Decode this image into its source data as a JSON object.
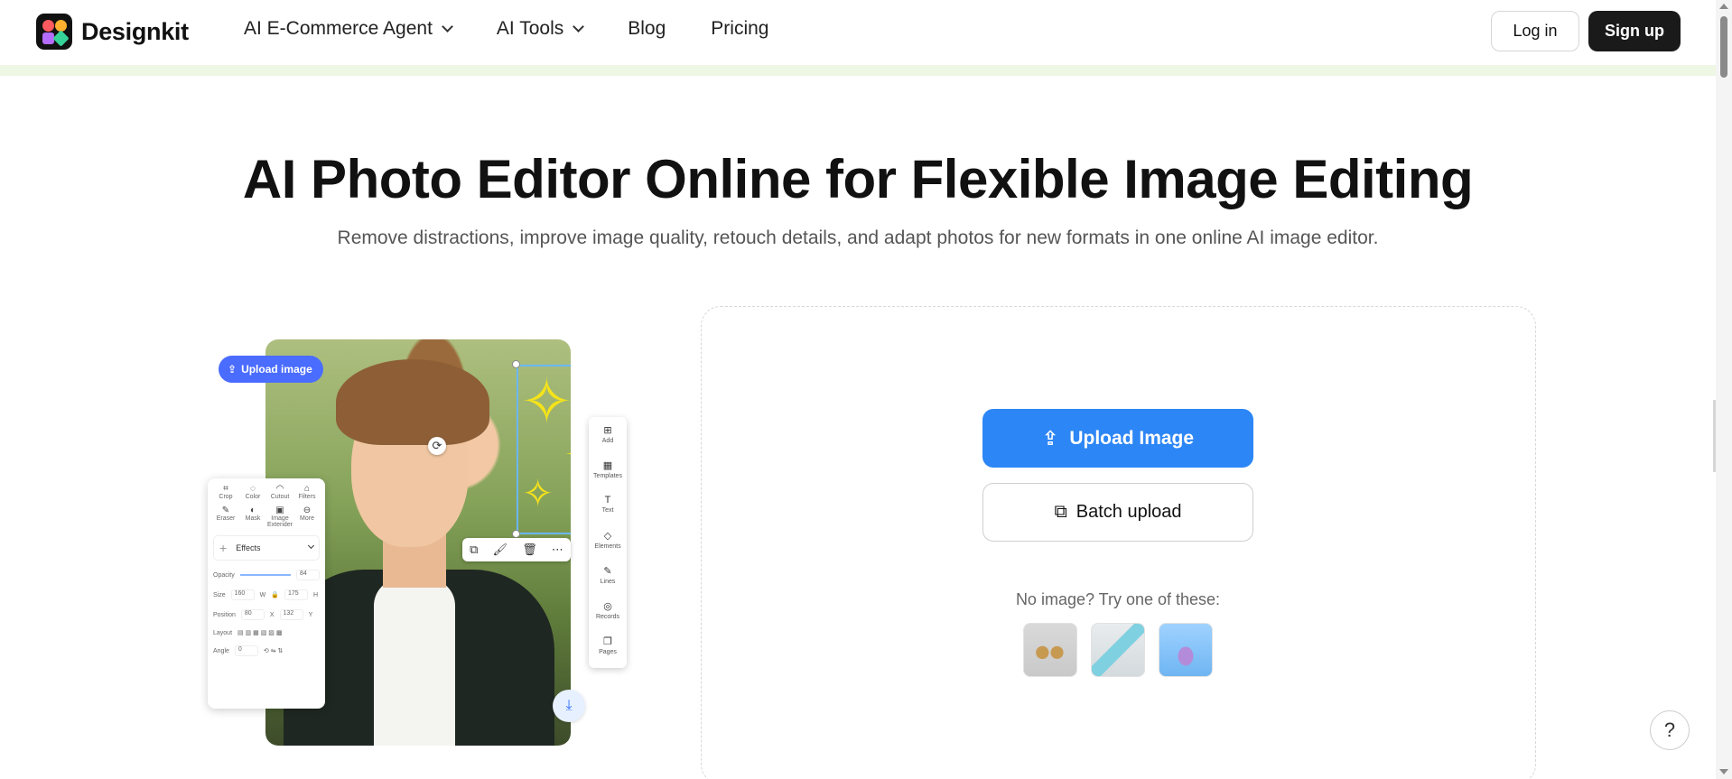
{
  "header": {
    "brand": "Designkit",
    "nav": [
      {
        "label": "AI E-Commerce Agent",
        "dropdown": true
      },
      {
        "label": "AI Tools",
        "dropdown": true
      },
      {
        "label": "Blog",
        "dropdown": false
      },
      {
        "label": "Pricing",
        "dropdown": false
      }
    ],
    "login_label": "Log in",
    "signup_label": "Sign up"
  },
  "hero": {
    "title": "AI Photo Editor Online for Flexible Image Editing",
    "subtitle": "Remove distractions, improve image quality, retouch details, and adapt photos for new formats in one online AI image editor."
  },
  "illustration": {
    "upload_pill": "Upload image",
    "panel_tools_row1": [
      "Crop",
      "Color",
      "Cutout",
      "Filters"
    ],
    "panel_tools_row2": [
      "Eraser",
      "Mask",
      "Image Extender",
      "More"
    ],
    "effects_label": "Effects",
    "opacity_label": "Opacity",
    "opacity_value": "84",
    "size_label": "Size",
    "size_w": "160",
    "size_w_unit": "W",
    "size_h": "175",
    "size_h_unit": "H",
    "position_label": "Position",
    "position_x": "80",
    "position_x_unit": "X",
    "position_y": "132",
    "position_y_unit": "Y",
    "layout_label": "Layout",
    "angle_label": "Angle",
    "angle_value": "0",
    "rail": [
      "Add",
      "Templates",
      "Text",
      "Elements",
      "Lines",
      "Records",
      "Pages"
    ]
  },
  "upload": {
    "upload_button": "Upload Image",
    "batch_button": "Batch upload",
    "try_text": "No image? Try one of these:"
  },
  "help_label": "?",
  "colors": {
    "primary": "#2d86f5",
    "dark": "#1a1a1a",
    "pill": "#4a6cff"
  }
}
